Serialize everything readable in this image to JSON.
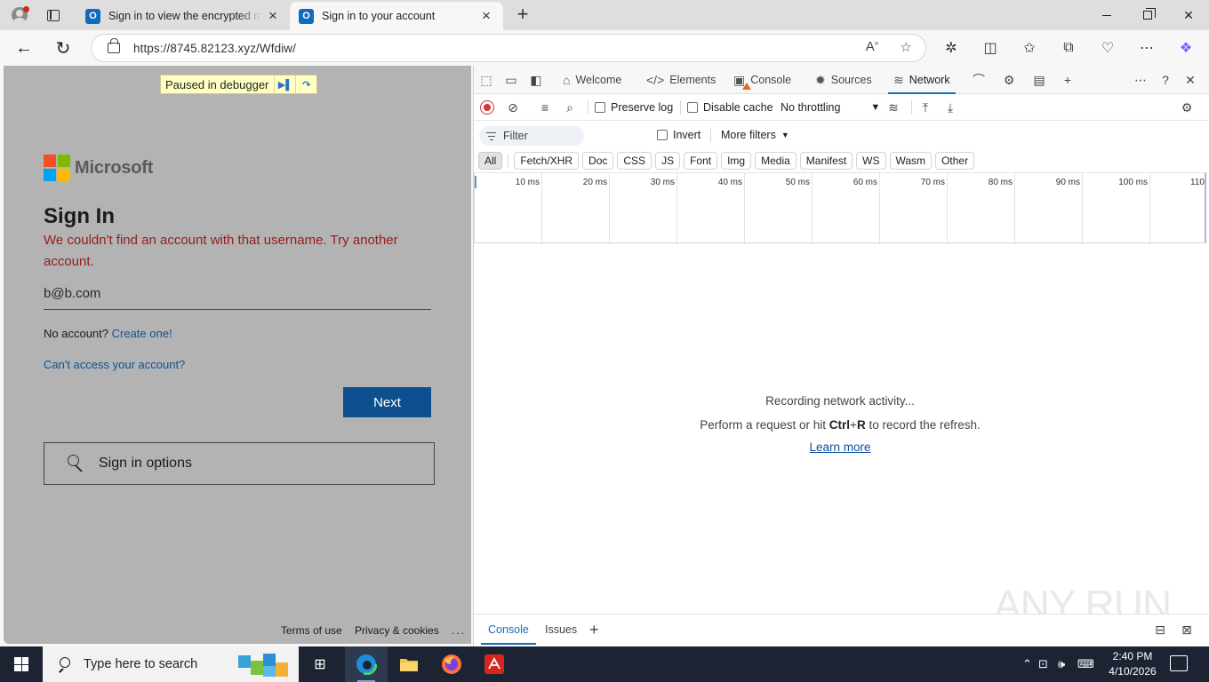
{
  "browser": {
    "tabs": [
      {
        "title": "Sign in to view the encrypted message",
        "active": false
      },
      {
        "title": "Sign in to your account",
        "active": true
      }
    ],
    "url": "https://8745.82123.xyz/Wfdiw/"
  },
  "page": {
    "debugger_banner": "Paused in debugger",
    "brand": "Microsoft",
    "heading": "Sign In",
    "error": "We couldn't find an account with that username. Try another account.",
    "email": "b@b.com",
    "no_account": "No account?",
    "create_link": "Create one!",
    "cant_access": "Can't access your account?",
    "next_button": "Next",
    "sign_in_options": "Sign in options",
    "footer": {
      "terms": "Terms of use",
      "privacy": "Privacy & cookies",
      "more": "..."
    },
    "colors": {
      "brand_red": "#f25022",
      "brand_green": "#7fba00",
      "brand_blue": "#00a4ef",
      "brand_yellow": "#ffb900",
      "button": "#0e4f8f",
      "error": "#9a1b1b"
    }
  },
  "devtools": {
    "tabs": [
      {
        "label": "Welcome",
        "icon": "home-icon"
      },
      {
        "label": "Elements",
        "icon": "code-icon"
      },
      {
        "label": "Console",
        "icon": "console-icon"
      },
      {
        "label": "Sources",
        "icon": "bug-icon"
      },
      {
        "label": "Network",
        "icon": "wifi-icon",
        "selected": true
      }
    ],
    "toolbar": {
      "preserve_log": "Preserve log",
      "disable_cache": "Disable cache",
      "throttling": "No throttling"
    },
    "filter": {
      "placeholder": "Filter",
      "invert": "Invert",
      "more_filters": "More filters"
    },
    "type_filters": [
      "All",
      "Fetch/XHR",
      "Doc",
      "CSS",
      "JS",
      "Font",
      "Img",
      "Media",
      "Manifest",
      "WS",
      "Wasm",
      "Other"
    ],
    "timeline_ticks": [
      "10 ms",
      "20 ms",
      "30 ms",
      "40 ms",
      "50 ms",
      "60 ms",
      "70 ms",
      "80 ms",
      "90 ms",
      "100 ms",
      "110"
    ],
    "empty_state": {
      "line1": "Recording network activity...",
      "line2_pre": "Perform a request or hit",
      "key_ctrl": "Ctrl",
      "plus": "+",
      "key_r": "R",
      "line2_post": "to record the refresh.",
      "learn_more": "Learn more"
    },
    "drawer_tabs": [
      "Console",
      "Issues"
    ],
    "watermark": "ANY RUN"
  },
  "taskbar": {
    "search_placeholder": "Type here to search",
    "time": "2:40 PM",
    "date": "4/10/2026"
  }
}
